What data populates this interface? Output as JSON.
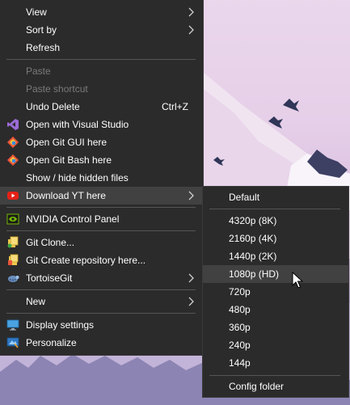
{
  "context_menu": {
    "items": [
      {
        "label": "View"
      },
      {
        "label": "Sort by"
      },
      {
        "label": "Refresh"
      },
      {
        "label": "Paste"
      },
      {
        "label": "Paste shortcut"
      },
      {
        "label": "Undo Delete",
        "shortcut": "Ctrl+Z"
      },
      {
        "label": "Open with Visual Studio"
      },
      {
        "label": "Open Git GUI here"
      },
      {
        "label": "Open Git Bash here"
      },
      {
        "label": "Show / hide hidden files"
      },
      {
        "label": "Download YT here"
      },
      {
        "label": "NVIDIA Control Panel"
      },
      {
        "label": "Git Clone..."
      },
      {
        "label": "Git Create repository here..."
      },
      {
        "label": "TortoiseGit"
      },
      {
        "label": "New"
      },
      {
        "label": "Display settings"
      },
      {
        "label": "Personalize"
      }
    ]
  },
  "submenu": {
    "items": [
      {
        "label": "Default"
      },
      {
        "label": "4320p (8K)"
      },
      {
        "label": "2160p (4K)"
      },
      {
        "label": "1440p (2K)"
      },
      {
        "label": "1080p (HD)"
      },
      {
        "label": "720p"
      },
      {
        "label": "480p"
      },
      {
        "label": "360p"
      },
      {
        "label": "240p"
      },
      {
        "label": "144p"
      },
      {
        "label": "Config folder"
      }
    ]
  },
  "colors": {
    "menu_bg": "#2b2b2b",
    "highlight": "#414141",
    "disabled_text": "#7a7a7a",
    "text": "#ffffff"
  }
}
